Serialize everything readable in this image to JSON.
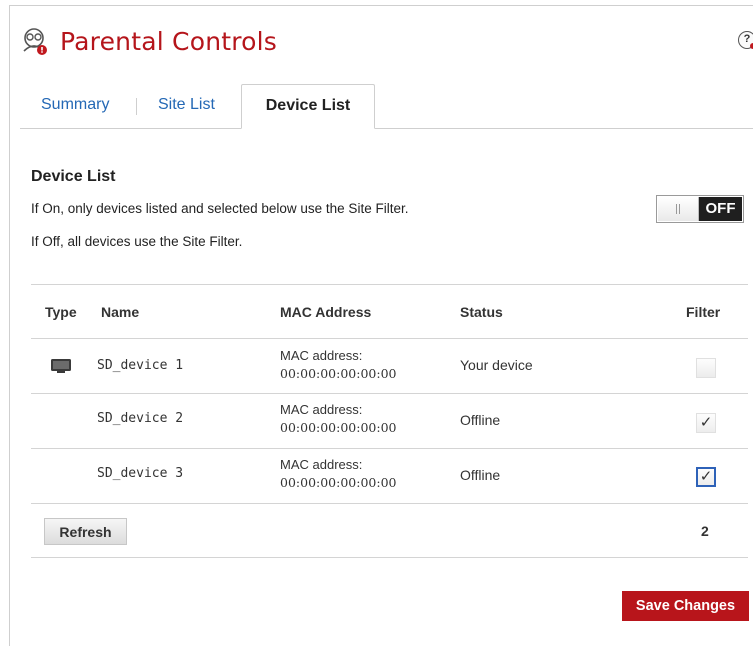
{
  "header": {
    "title": "Parental Controls",
    "help_label": "?",
    "icon": "parental-controls-icon"
  },
  "tabs": [
    {
      "label": "Summary",
      "active": false
    },
    {
      "label": "Site List",
      "active": false
    },
    {
      "label": "Device List",
      "active": true
    }
  ],
  "section": {
    "title": "Device List",
    "desc_on": "If On, only devices listed and selected below use the Site Filter.",
    "desc_off": "If Off, all devices use the Site Filter.",
    "toggle": {
      "state_label": "OFF",
      "on": false
    }
  },
  "table": {
    "headers": {
      "type": "Type",
      "name": "Name",
      "mac": "MAC Address",
      "status": "Status",
      "filter": "Filter"
    },
    "rows": [
      {
        "type_icon": "monitor-icon",
        "name": "SD_device 1",
        "mac_label": "MAC address:",
        "mac": "00:00:00:00:00:00",
        "status": "Your device",
        "filter_checked": false
      },
      {
        "type_icon": "",
        "name": "SD_device 2",
        "mac_label": "MAC address:",
        "mac": "00:00:00:00:00:00",
        "status": "Offline",
        "filter_checked": true
      },
      {
        "type_icon": "",
        "name": "SD_device 3",
        "mac_label": "MAC address:",
        "mac": "00:00:00:00:00:00",
        "status": "Offline",
        "filter_checked": true
      }
    ]
  },
  "footer": {
    "refresh_label": "Refresh",
    "selected_count": "2",
    "save_label": "Save Changes"
  },
  "colors": {
    "brand_red": "#b8151b",
    "link_blue": "#2468b5",
    "focus_blue": "#2e62b8"
  }
}
